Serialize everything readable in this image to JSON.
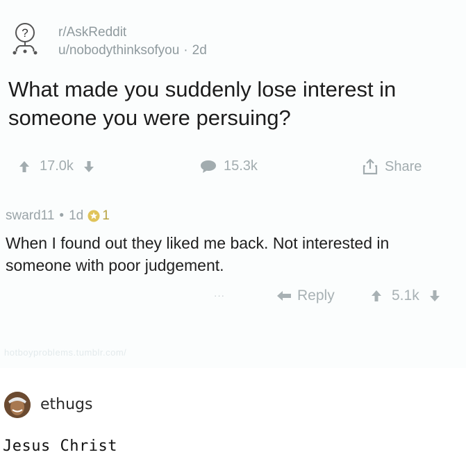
{
  "post": {
    "subreddit": "r/AskReddit",
    "author": "u/nobodythinksofyou",
    "separator": "·",
    "age": "2d",
    "title": "What made you suddenly lose interest in someone you were persuing?",
    "votes": "17.0k",
    "comments": "15.3k",
    "share_label": "Share"
  },
  "comment": {
    "author": "sward11",
    "separator": "•",
    "age": "1d",
    "gold_count": "1",
    "body": "When I found out they liked me back. Not interested in someone with poor judgement.",
    "more": "···",
    "reply_label": "Reply",
    "votes": "5.1k"
  },
  "watermark": "hotboyproblems.tumblr.com/",
  "reblog": {
    "username": "ethugs",
    "text": "Jesus Christ"
  },
  "colors": {
    "muted_text": "#8f9a9e",
    "gold": "#e0c45a",
    "card_bg": "#fbfdfd"
  }
}
